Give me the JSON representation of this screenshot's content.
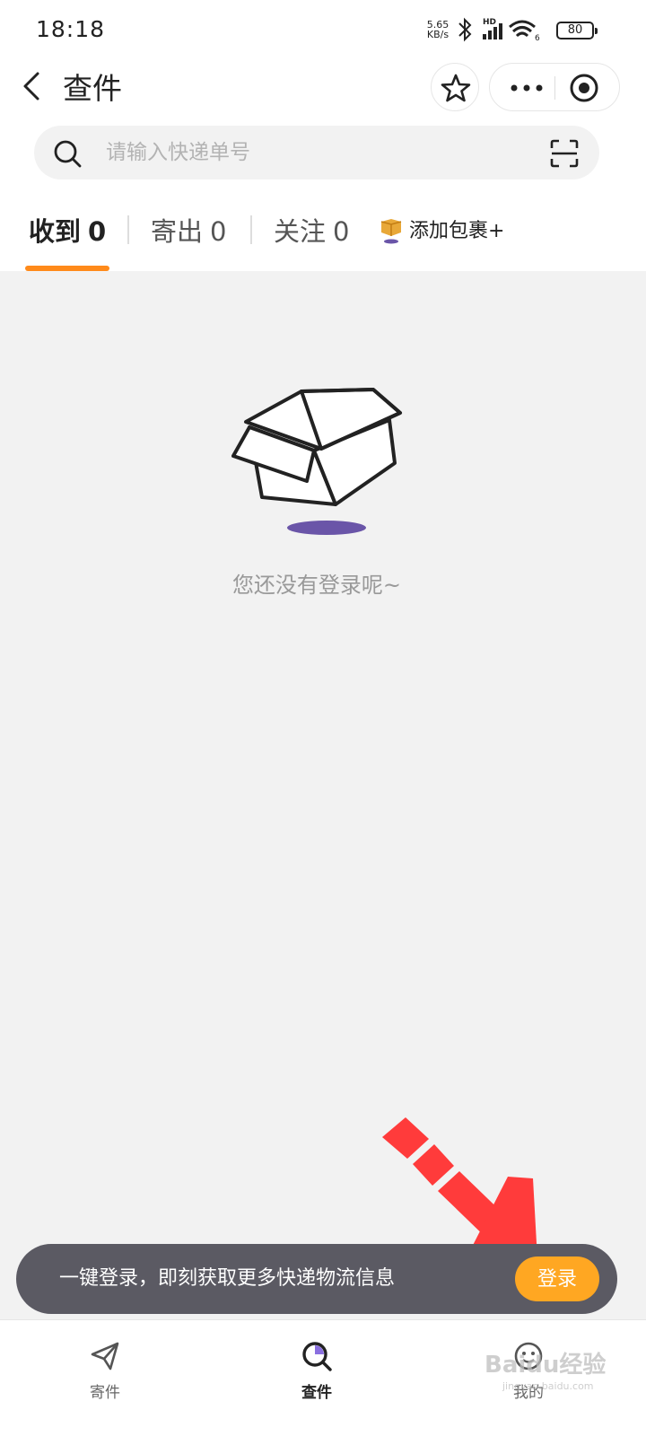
{
  "status_bar": {
    "time": "18:18",
    "net_speed_value": "5.65",
    "net_speed_unit": "KB/s",
    "network_label": "HD",
    "wifi_label": "6",
    "battery": "80"
  },
  "nav": {
    "title": "查件",
    "icons": [
      "back-icon",
      "star-icon",
      "more-icon",
      "close-target-icon"
    ]
  },
  "search": {
    "placeholder": "请输入快递单号",
    "value": ""
  },
  "tabs": [
    {
      "label": "收到",
      "count": "0",
      "active": true
    },
    {
      "label": "寄出",
      "count": "0",
      "active": false
    },
    {
      "label": "关注",
      "count": "0",
      "active": false
    }
  ],
  "add_package": {
    "label": "添加包裹+"
  },
  "empty_state": {
    "message": "您还没有登录呢~"
  },
  "login_banner": {
    "text": "一键登录，即刻获取更多快递物流信息",
    "button": "登录"
  },
  "tabbar": [
    {
      "label": "寄件",
      "icon": "send-icon",
      "active": false
    },
    {
      "label": "查件",
      "icon": "search-icon",
      "active": true
    },
    {
      "label": "我的",
      "icon": "profile-icon",
      "active": false
    }
  ],
  "watermark": {
    "text": "Baidu经验",
    "sub": "jingyan.baidu.com"
  },
  "colors": {
    "accent": "#ff8a1a",
    "login_button": "#ffa722",
    "banner": "#5b5a63",
    "annotation_arrow": "#ff3b3b",
    "shadow": "#6a55a8"
  }
}
